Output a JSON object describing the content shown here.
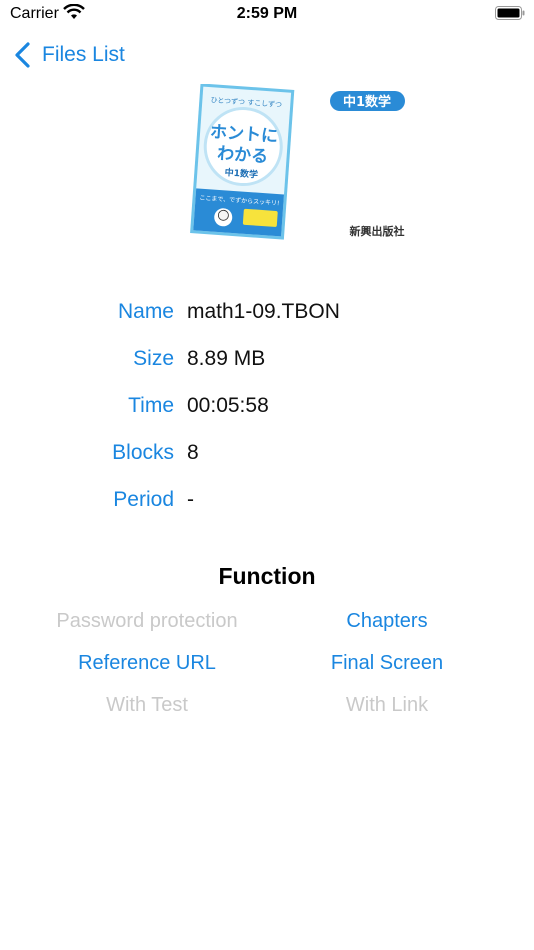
{
  "status_bar": {
    "carrier": "Carrier",
    "time": "2:59 PM"
  },
  "nav": {
    "back_label": "Files List"
  },
  "cover": {
    "top_text": "ひとつずつ すこしずつ",
    "title_line1": "ホントに",
    "title_line2": "わかる",
    "subtitle": "中1数学",
    "tagline": "ここまで、でずからスッキリ!",
    "badge": "中1数学",
    "publisher": "新興出版社"
  },
  "info": {
    "name_label": "Name",
    "name_value": "math1-09.TBON",
    "size_label": "Size",
    "size_value": "8.89 MB",
    "time_label": "Time",
    "time_value": "00:05:58",
    "blocks_label": "Blocks",
    "blocks_value": "8",
    "period_label": "Period",
    "period_value": "-"
  },
  "function": {
    "title": "Function",
    "password": "Password protection",
    "chapters": "Chapters",
    "reference_url": "Reference URL",
    "final_screen": "Final Screen",
    "with_test": "With Test",
    "with_link": "With Link"
  },
  "colors": {
    "accent": "#1a86e0",
    "disabled": "#c9c9c9"
  }
}
